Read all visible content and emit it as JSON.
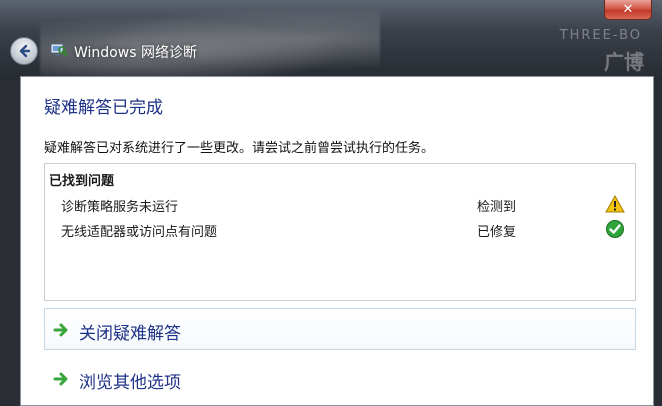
{
  "window": {
    "title": "Windows 网络诊断",
    "close_symbol": "✕",
    "background_text": "THREE-BO",
    "background_text2": "广博"
  },
  "main": {
    "heading": "疑难解答已完成",
    "description": "疑难解答已对系统进行了一些更改。请尝试之前曾尝试执行的任务。",
    "problems": {
      "title": "已找到问题",
      "items": [
        {
          "name": "诊断策略服务未运行",
          "status": "检测到",
          "icon": "warning-icon"
        },
        {
          "name": "无线适配器或访问点有问题",
          "status": "已修复",
          "icon": "check-icon"
        }
      ]
    },
    "actions": [
      {
        "label": "关闭疑难解答",
        "icon": "green-arrow-icon"
      },
      {
        "label": "浏览其他选项",
        "icon": "green-arrow-icon"
      }
    ]
  },
  "colors": {
    "heading": "#1e3287",
    "warning": "#f2c40f",
    "success": "#2ea43a",
    "arrow": "#3aa53a"
  }
}
